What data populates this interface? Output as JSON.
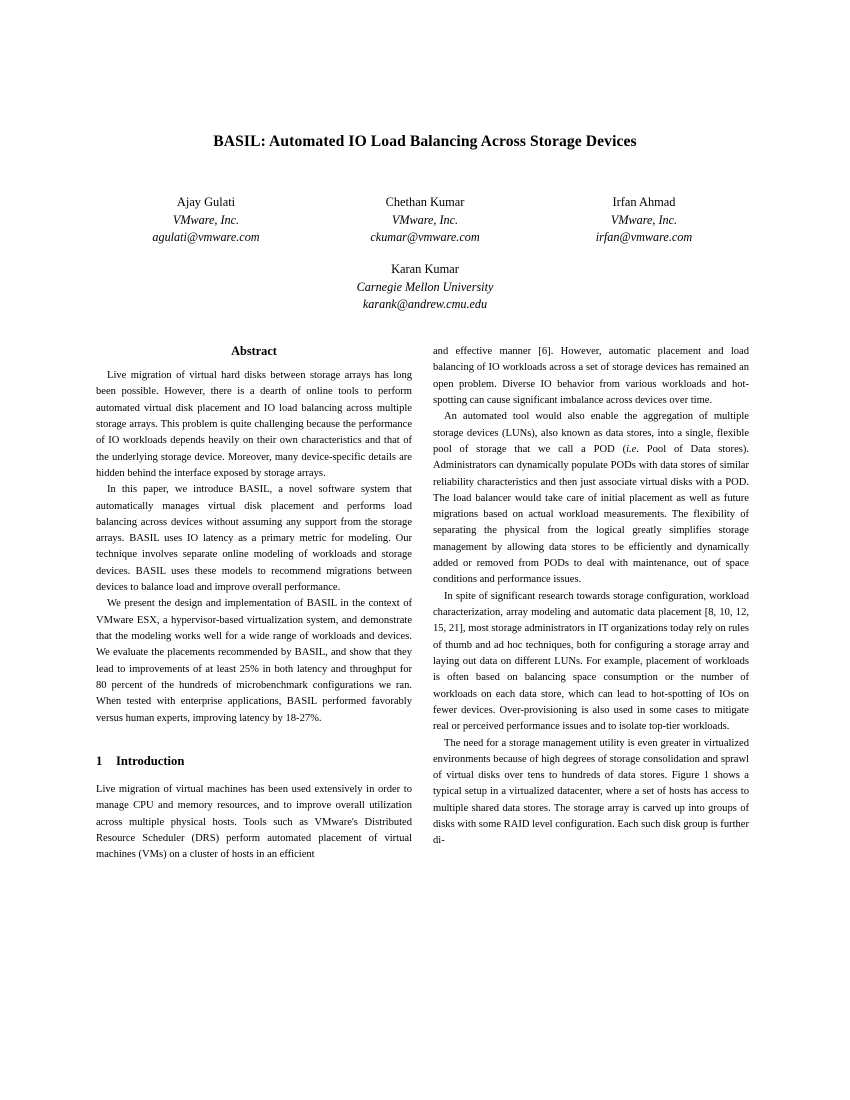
{
  "paper": {
    "title": "BASIL: Automated IO Load Balancing Across Storage Devices",
    "authors": [
      {
        "name": "Ajay Gulati",
        "affiliation": "VMware, Inc.",
        "email": "agulati@vmware.com"
      },
      {
        "name": "Chethan Kumar",
        "affiliation": "VMware, Inc.",
        "email": "ckumar@vmware.com"
      },
      {
        "name": "Irfan Ahmad",
        "affiliation": "VMware, Inc.",
        "email": "irfan@vmware.com"
      }
    ],
    "author_solo": {
      "name": "Karan Kumar",
      "affiliation": "Carnegie Mellon University",
      "email": "karank@andrew.cmu.edu"
    },
    "abstract": {
      "heading": "Abstract",
      "paragraphs": [
        "Live migration of virtual hard disks between storage arrays has long been possible. However, there is a dearth of online tools to perform automated virtual disk placement and IO load balancing across multiple storage arrays. This problem is quite challenging because the performance of IO workloads depends heavily on their own characteristics and that of the underlying storage device. Moreover, many device-specific details are hidden behind the interface exposed by storage arrays.",
        "In this paper, we introduce BASIL, a novel software system that automatically manages virtual disk placement and performs load balancing across devices without assuming any support from the storage arrays. BASIL uses IO latency as a primary metric for modeling. Our technique involves separate online modeling of workloads and storage devices. BASIL uses these models to recommend migrations between devices to balance load and improve overall performance.",
        "We present the design and implementation of BASIL in the context of VMware ESX, a hypervisor-based virtualization system, and demonstrate that the modeling works well for a wide range of workloads and devices. We evaluate the placements recommended by BASIL, and show that they lead to improvements of at least 25% in both latency and throughput for 80 percent of the hundreds of microbenchmark configurations we ran. When tested with enterprise applications, BASIL performed favorably versus human experts, improving latency by 18-27%."
      ]
    },
    "sections": [
      {
        "number": "1",
        "heading": "Introduction",
        "paragraphs": [
          "Live migration of virtual machines has been used extensively in order to manage CPU and memory resources, and to improve overall utilization across multiple physical hosts. Tools such as VMware's Distributed Resource Scheduler (DRS) perform automated placement of virtual machines (VMs) on a cluster of hosts in an efficient and effective manner [6]. However, automatic placement and load balancing of IO workloads across a set of storage devices has remained an open problem. Diverse IO behavior from various workloads and hot-spotting can cause significant imbalance across devices over time."
        ]
      }
    ],
    "right_column": {
      "para_pod_part1": "An automated tool would also enable the aggregation of multiple storage devices (LUNs), also known as data stores, into a single, flexible pool of storage that we call a POD (",
      "para_pod_italic": "i.e.",
      "para_pod_part2": " Pool of Data stores). Administrators can dynamically populate PODs with data stores of similar reliability characteristics and then just associate virtual disks with a POD. The load balancer would take care of initial placement as well as future migrations based on actual workload measurements. The flexibility of separating the physical from the logical greatly simplifies storage management by allowing data stores to be efficiently and dynamically added or removed from PODs to deal with maintenance, out of space conditions and performance issues.",
      "para_research": "In spite of significant research towards storage configuration, workload characterization, array modeling and automatic data placement [8, 10, 12, 15, 21], most storage administrators in IT organizations today rely on rules of thumb and ad hoc techniques, both for configuring a storage array and laying out data on different LUNs. For example, placement of workloads is often based on balancing space consumption or the number of workloads on each data store, which can lead to hot-spotting of IOs on fewer devices. Over-provisioning is also used in some cases to mitigate real or perceived performance issues and to isolate top-tier workloads.",
      "para_need": "The need for a storage management utility is even greater in virtualized environments because of high degrees of storage consolidation and sprawl of virtual disks over tens to hundreds of data stores. Figure 1 shows a typical setup in a virtualized datacenter, where a set of hosts has access to multiple shared data stores. The storage array is carved up into groups of disks with some RAID level configuration. Each such disk group is further di-"
    },
    "colors": {
      "page_background": "#ffffff",
      "text": "#000000"
    }
  }
}
